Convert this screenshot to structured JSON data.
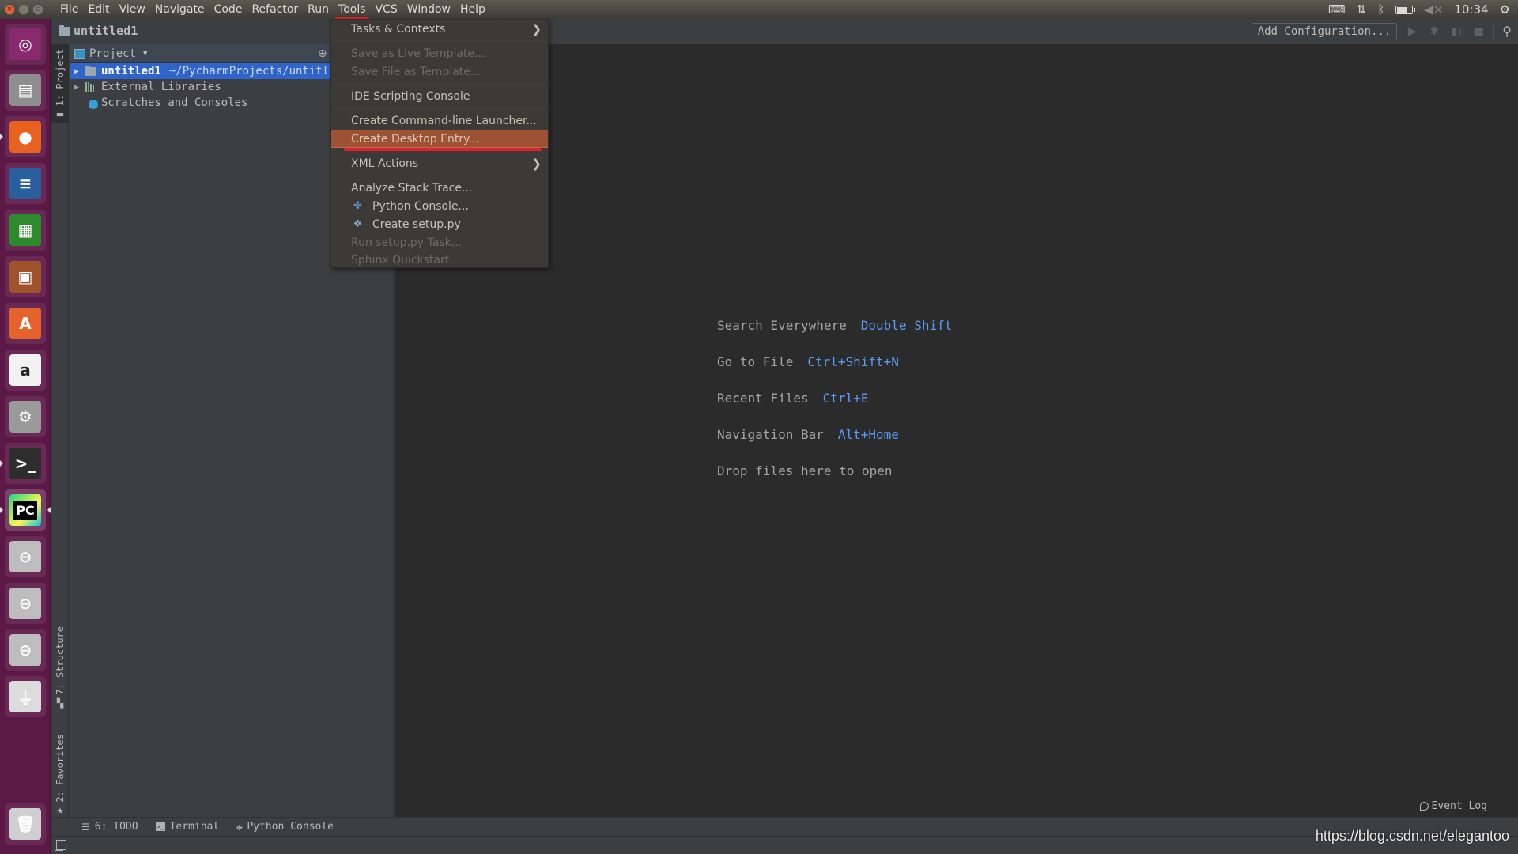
{
  "top_panel": {
    "menus": [
      {
        "label": "File"
      },
      {
        "label": "Edit"
      },
      {
        "label": "View"
      },
      {
        "label": "Navigate"
      },
      {
        "label": "Code"
      },
      {
        "label": "Refactor"
      },
      {
        "label": "Run"
      },
      {
        "label": "Tools",
        "active": true
      },
      {
        "label": "VCS"
      },
      {
        "label": "Window"
      },
      {
        "label": "Help"
      }
    ],
    "indicators": {
      "keyboard": "keyboard-icon",
      "network": "network-icon",
      "bluetooth": "bluetooth-icon",
      "battery": "battery-icon",
      "volume": "volume-muted-icon",
      "clock": "10:34",
      "session": "gear-icon"
    }
  },
  "launcher": {
    "items": [
      {
        "name": "ubuntu-dash",
        "glyph": "◎",
        "color": "#8a2a6e"
      },
      {
        "name": "files",
        "glyph": "▤",
        "color": "#8e8e8e"
      },
      {
        "name": "firefox",
        "glyph": "●",
        "color": "#e8611e",
        "running": true
      },
      {
        "name": "libreoffice-writer",
        "glyph": "≡",
        "color": "#2a5f9e"
      },
      {
        "name": "libreoffice-calc",
        "glyph": "▦",
        "color": "#2c8a2c"
      },
      {
        "name": "libreoffice-impress",
        "glyph": "▣",
        "color": "#a0522d"
      },
      {
        "name": "software-center",
        "glyph": "A",
        "color": "#e5622d"
      },
      {
        "name": "amazon",
        "glyph": "a",
        "color": "#f2f2f2"
      },
      {
        "name": "system-settings",
        "glyph": "⚙",
        "color": "#9a9a9a"
      },
      {
        "name": "terminal",
        "glyph": ">_",
        "color": "#2d2d2d",
        "running": true
      },
      {
        "name": "pycharm",
        "glyph": "PC",
        "color": "#21d789",
        "running": true,
        "focused": true
      },
      {
        "name": "drive-1",
        "glyph": "⊖",
        "color": "#bdbdbd"
      },
      {
        "name": "drive-2",
        "glyph": "⊖",
        "color": "#bdbdbd"
      },
      {
        "name": "drive-3",
        "glyph": "⊖",
        "color": "#bdbdbd"
      },
      {
        "name": "usb-drive",
        "glyph": "⏚",
        "color": "#dcdcdc"
      },
      {
        "name": "trash",
        "glyph": "🗑",
        "color": "#cfcfcf"
      }
    ]
  },
  "navbar": {
    "breadcrumb": "untitled1",
    "add_configuration": "Add Configuration..."
  },
  "left_strip": {
    "project_tab": "1: Project",
    "structure_tab": "7: Structure",
    "favorites_tab": "2: Favorites"
  },
  "project_panel": {
    "title": "Project",
    "tree": [
      {
        "label": "untitled1",
        "path": "~/PycharmProjects/untitled1",
        "selected": true,
        "expandable": true
      },
      {
        "label": "External Libraries",
        "expandable": true
      },
      {
        "label": "Scratches and Consoles",
        "expandable": false
      }
    ]
  },
  "editor": {
    "hints": [
      {
        "action": "Search Everywhere",
        "shortcut": "Double Shift"
      },
      {
        "action": "Go to File",
        "shortcut": "Ctrl+Shift+N"
      },
      {
        "action": "Recent Files",
        "shortcut": "Ctrl+E"
      },
      {
        "action": "Navigation Bar",
        "shortcut": "Alt+Home"
      },
      {
        "action": "Drop files here to open",
        "shortcut": ""
      }
    ]
  },
  "bottom_bar": {
    "todo": "6: TODO",
    "terminal": "Terminal",
    "python_console": "Python Console",
    "event_log": "Event Log"
  },
  "tools_menu": {
    "items": [
      {
        "label": "Tasks & Contexts",
        "submenu": true,
        "enabled": true
      },
      {
        "label": "Save as Live Template...",
        "enabled": false
      },
      {
        "label": "Save File as Template...",
        "enabled": false
      },
      {
        "label": "IDE Scripting Console",
        "enabled": true
      },
      {
        "label": "Create Command-line Launcher...",
        "enabled": true
      },
      {
        "label": "Create Desktop Entry...",
        "enabled": true,
        "highlighted": true
      },
      {
        "label": "XML Actions",
        "submenu": true,
        "enabled": true
      },
      {
        "label": "Analyze Stack Trace...",
        "enabled": true
      },
      {
        "label": "Python Console...",
        "enabled": true,
        "icon": "python-icon"
      },
      {
        "label": "Create setup.py",
        "enabled": true,
        "icon": "setup-py-icon"
      },
      {
        "label": "Run setup.py Task...",
        "enabled": false
      },
      {
        "label": "Sphinx Quickstart",
        "enabled": false
      }
    ]
  },
  "watermark": "https://blog.csdn.net/elegantoo",
  "colors": {
    "menu_highlight": "#9d5233",
    "annotation_red": "#e0202a",
    "selection_blue": "#2f65ca",
    "shortcut_blue": "#589df6",
    "launcher_bg": "#5c1846"
  }
}
